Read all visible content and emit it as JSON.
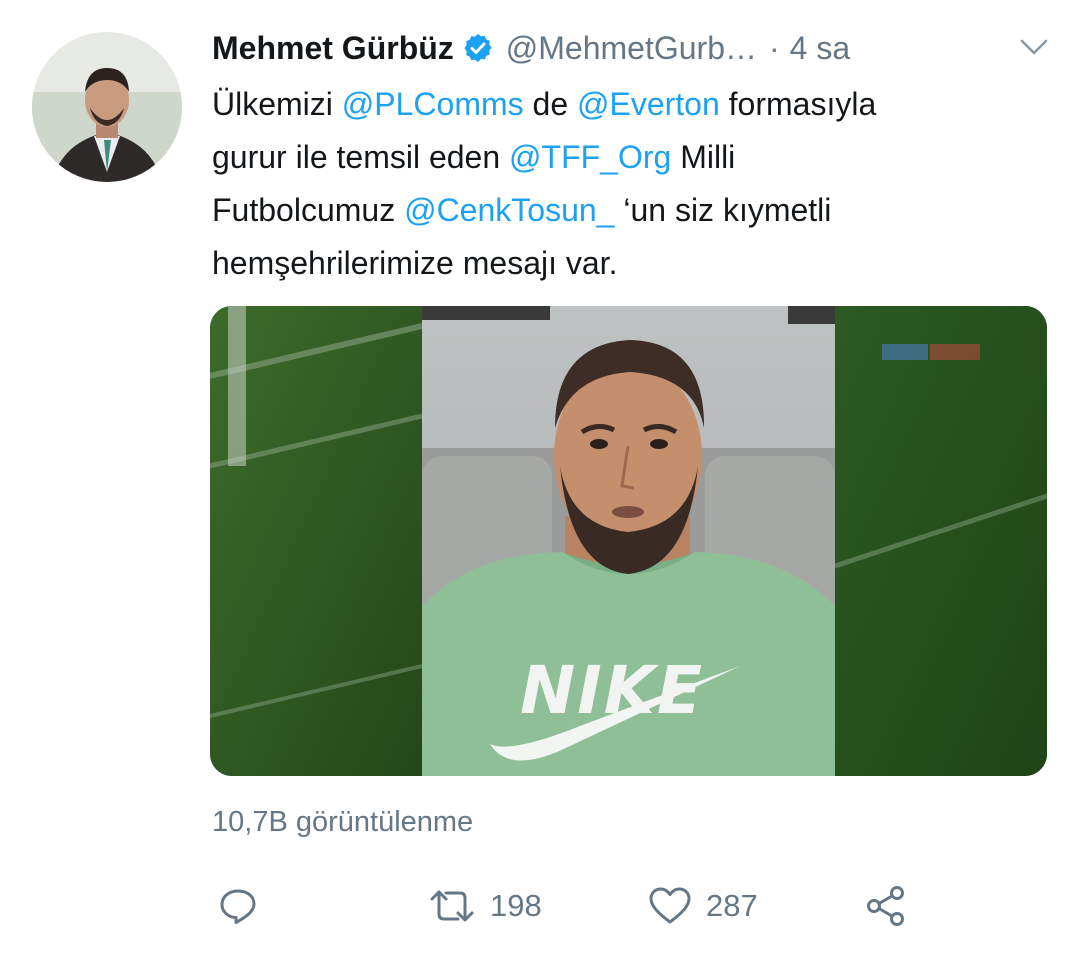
{
  "tweet": {
    "author_name": "Mehmet Gürbüz",
    "handle": "@MehmetGurb…",
    "separator": "·",
    "time": "4 sa",
    "text_lines": [
      [
        {
          "t": "Ülkemizi ",
          "mention": false
        },
        {
          "t": "@PLComms",
          "mention": true
        },
        {
          "t": " de ",
          "mention": false
        },
        {
          "t": "@Everton",
          "mention": true
        },
        {
          "t": " formasıyla",
          "mention": false
        }
      ],
      [
        {
          "t": "gurur ile temsil eden ",
          "mention": false
        },
        {
          "t": "@TFF_Org",
          "mention": true
        },
        {
          "t": " Milli",
          "mention": false
        }
      ],
      [
        {
          "t": "Futbolcumuz ",
          "mention": false
        },
        {
          "t": "@CenkTosun_",
          "mention": true
        },
        {
          "t": " ‘un siz kıymetli",
          "mention": false
        }
      ],
      [
        {
          "t": "hemşehrilerimize mesajı var.",
          "mention": false
        }
      ]
    ],
    "video": {
      "shirt_text": "NIKE"
    },
    "views_label": "10,7B görüntülenme",
    "actions": {
      "reply_icon": "reply-icon",
      "retweet_icon": "retweet-icon",
      "retweet_count": "198",
      "like_icon": "heart-icon",
      "like_count": "287",
      "share_icon": "share-icon"
    }
  },
  "colors": {
    "text": "#14171a",
    "secondary": "#657786",
    "link": "#1da1f2",
    "verified": "#1da1f2",
    "pitch": "#2f5a1f",
    "shirt": "#8fbf97"
  }
}
